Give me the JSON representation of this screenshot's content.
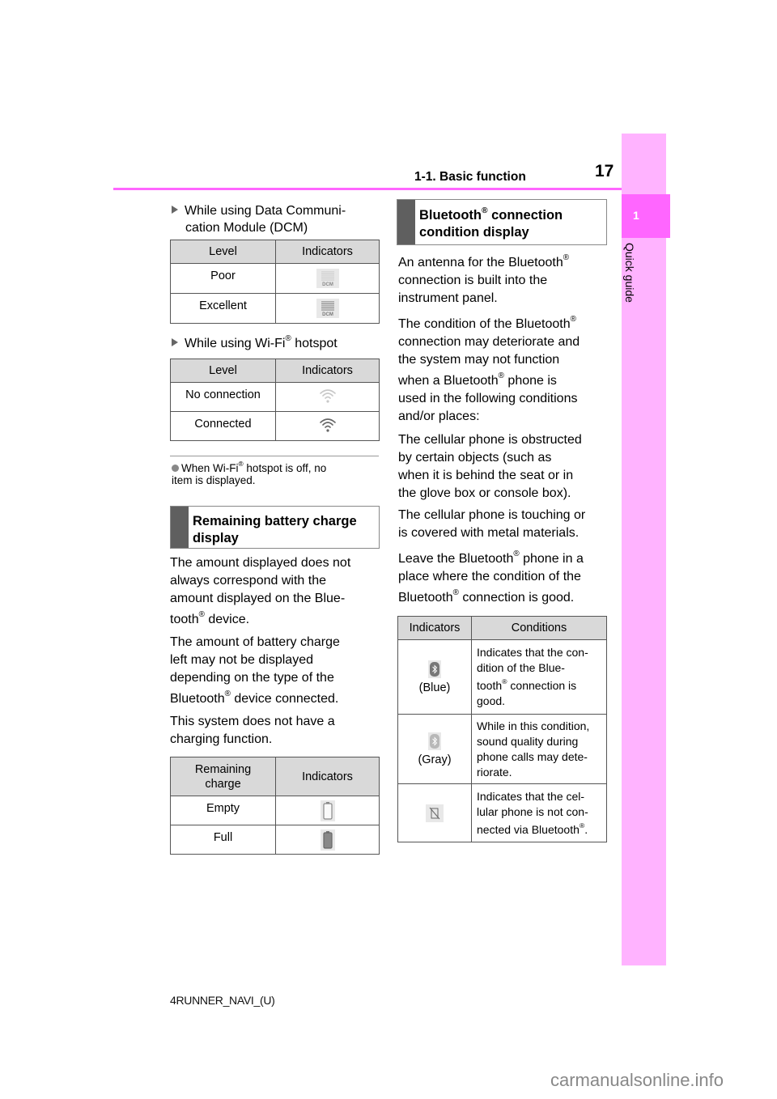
{
  "header": {
    "section_title": "1-1. Basic function",
    "page_number": "17"
  },
  "side_tab": {
    "chapter_number": "1",
    "chapter_label": "Quick guide",
    "colors": {
      "bar": "#ffb3ff",
      "active": "#ff66ff"
    }
  },
  "left_column": {
    "dcm": {
      "heading": "While using Data Communi-cation Module (DCM)",
      "heading_line1": "While using Data Communi-",
      "heading_line2": "cation Module (DCM)",
      "columns": [
        "Level",
        "Indicators"
      ],
      "rows": [
        {
          "level": "Poor",
          "icon": "dcm-signal-poor-icon",
          "icon_text": "DCM"
        },
        {
          "level": "Excellent",
          "icon": "dcm-signal-excellent-icon",
          "icon_text": "DCM"
        }
      ]
    },
    "wifi": {
      "heading_pre": "While using Wi-Fi",
      "heading_post": " hotspot",
      "reg": "®",
      "columns": [
        "Level",
        "Indicators"
      ],
      "rows": [
        {
          "level": "No connection",
          "icon": "wifi-no-connection-icon"
        },
        {
          "level": "Connected",
          "icon": "wifi-connected-icon"
        }
      ]
    },
    "wifi_note": {
      "pre": "When Wi-Fi",
      "post": " hotspot is off, no",
      "line2": "item is displayed."
    },
    "battery_section": {
      "title_line1": "Remaining battery charge",
      "title_line2": "display",
      "para1": {
        "l1": "The amount displayed does not",
        "l2": "always correspond with the",
        "l3": "amount displayed on the Blue-",
        "l4_pre": "tooth",
        "l4_post": " device."
      },
      "para2": {
        "l1": "The amount of battery charge",
        "l2": "left may not be displayed",
        "l3": "depending on the type of the",
        "l4_pre": "Bluetooth",
        "l4_post": " device connected."
      },
      "para3": {
        "l1": "This system does not have a",
        "l2": "charging function."
      },
      "columns": [
        "Remaining charge",
        "Indicators"
      ],
      "col1_line1": "Remaining",
      "col1_line2": "charge",
      "rows": [
        {
          "level": "Empty",
          "icon": "battery-empty-icon"
        },
        {
          "level": "Full",
          "icon": "battery-full-icon"
        }
      ]
    }
  },
  "right_column": {
    "bt_section": {
      "title_pre": "Bluetooth",
      "title_post": " connection",
      "title_line2": "condition display"
    },
    "paras": {
      "p1_l1_pre": "An antenna for the Bluetooth",
      "p1_l2": "connection is built into the",
      "p1_l3": "instrument panel.",
      "p2_l1_pre": "The condition of the Bluetooth",
      "p2_l2": "connection may deteriorate and",
      "p2_l3": "the system may not function",
      "p2_l4_pre": "when a Bluetooth",
      "p2_l4_post": " phone is",
      "p2_l5": "used in the following conditions",
      "p2_l6": "and/or places:",
      "p3_l1": "The cellular phone is obstructed",
      "p3_l2": "by certain objects (such as",
      "p3_l3": "when it is behind the seat or in",
      "p3_l4": "the glove box or console box).",
      "p4_l1": "The cellular phone is touching or",
      "p4_l2": "is covered with metal materials.",
      "p5_l1_pre": "Leave the Bluetooth",
      "p5_l1_post": " phone in a",
      "p5_l2": "place where the condition of the",
      "p5_l3_pre": "Bluetooth",
      "p5_l3_post": " connection is good."
    },
    "bt_table": {
      "columns": [
        "Indicators",
        "Conditions"
      ],
      "rows": [
        {
          "icon": "bluetooth-blue-icon",
          "label": "(Blue)",
          "c1": "Indicates that the con-",
          "c2": "dition of the Blue-",
          "c3_pre": "tooth",
          "c3_post": " connection is",
          "c4": "good."
        },
        {
          "icon": "bluetooth-gray-icon",
          "label": "(Gray)",
          "c1": "While in this condition,",
          "c2": "sound quality during",
          "c3": "phone calls may dete-",
          "c4": "riorate."
        },
        {
          "icon": "phone-not-connected-icon",
          "label": "",
          "c1": "Indicates that the cel-",
          "c2": "lular phone is not con-",
          "c3_pre": "nected via Bluetooth",
          "c3_post": "."
        }
      ]
    }
  },
  "reg_mark": "®",
  "footer": {
    "model_code": "4RUNNER_NAVI_(U)"
  },
  "watermark": "carmanualsonline.info"
}
